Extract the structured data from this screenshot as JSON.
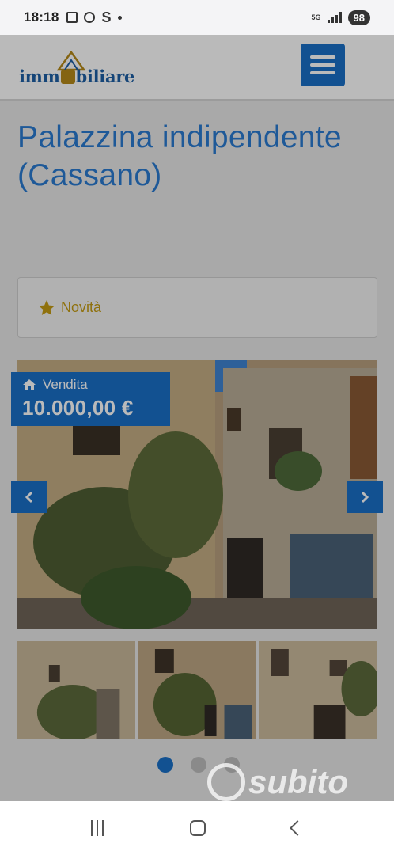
{
  "status_bar": {
    "time": "18:18",
    "s_letter": "S",
    "network": "5G",
    "battery": "98"
  },
  "header": {
    "logo_text_pre": "imm",
    "logo_text_post": "biliare"
  },
  "listing": {
    "title": "Palazzina indipendente (Cassano)",
    "badge_label": "Novità",
    "price_type": "Vendita",
    "price": "10.000,00 €",
    "gallery_dots_active": 1,
    "gallery_dots_total": 3
  },
  "watermark": {
    "text": "subito"
  },
  "colors": {
    "accent": "#1a6fc7",
    "title": "#2a7ad1",
    "star": "#c49b12"
  }
}
